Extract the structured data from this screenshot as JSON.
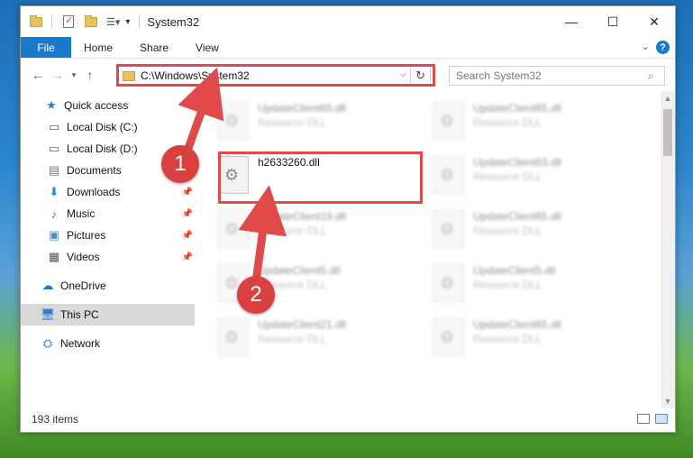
{
  "window": {
    "title": "System32"
  },
  "ribbon": {
    "tabs": [
      "File",
      "Home",
      "Share",
      "View"
    ],
    "help": "?"
  },
  "address": {
    "path": "C:\\Windows\\System32",
    "search_placeholder": "Search System32"
  },
  "nav": {
    "items": [
      {
        "label": "Quick access",
        "icon": "star-icon"
      },
      {
        "label": "Local Disk (C:)",
        "icon": "drive-icon"
      },
      {
        "label": "Local Disk (D:)",
        "icon": "drive-icon"
      },
      {
        "label": "Documents",
        "icon": "documents-icon"
      },
      {
        "label": "Downloads",
        "icon": "download-icon",
        "pinned": true
      },
      {
        "label": "Music",
        "icon": "music-icon",
        "pinned": true
      },
      {
        "label": "Pictures",
        "icon": "pictures-icon",
        "pinned": true
      },
      {
        "label": "Videos",
        "icon": "videos-icon",
        "pinned": true
      },
      {
        "label": "OneDrive",
        "icon": "cloud-icon"
      },
      {
        "label": "This PC",
        "icon": "computer-icon",
        "selected": true
      },
      {
        "label": "Network",
        "icon": "network-icon"
      }
    ]
  },
  "files": {
    "col1": [
      {
        "name": "UpdateClient65.dll",
        "type": "Resource DLL"
      },
      {
        "name": "h2633260.dll",
        "type": ""
      },
      {
        "name": "UpdateClient19.dll",
        "type": "Resource DLL"
      },
      {
        "name": "UpdateClient5.dll",
        "type": "Resource DLL"
      },
      {
        "name": "UpdateClient21.dll",
        "type": "Resource DLL"
      }
    ],
    "col2": [
      {
        "name": "UpdateClient65.dll",
        "type": "Resource DLL"
      },
      {
        "name": "UpdateClient63.dll",
        "type": "Resource DLL"
      },
      {
        "name": "UpdateClient65.dll",
        "type": "Resource DLL"
      },
      {
        "name": "UpdateClient5.dll",
        "type": "Resource DLL"
      },
      {
        "name": "UpdateClient65.dll",
        "type": "Resource DLL"
      }
    ]
  },
  "status": {
    "item_count": "193 items"
  },
  "annotations": {
    "step1": "1",
    "step2": "2",
    "color": "#e04a4a"
  }
}
